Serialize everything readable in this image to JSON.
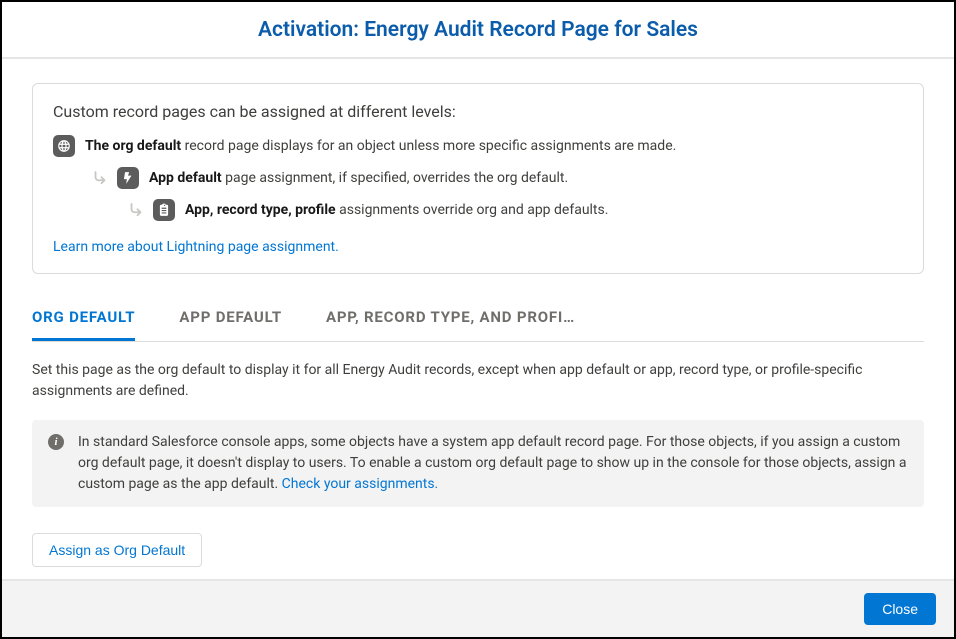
{
  "header": {
    "title": "Activation: Energy Audit Record Page for Sales"
  },
  "info": {
    "title": "Custom record pages can be assigned at different levels:",
    "levels": [
      {
        "label": "The org default",
        "desc": " record page displays for an object unless more specific assignments are made."
      },
      {
        "label": "App default",
        "desc": " page assignment, if specified, overrides the org default."
      },
      {
        "label": "App, record type, profile",
        "desc": " assignments override org and app defaults."
      }
    ],
    "learn_link": "Learn more about Lightning page assignment."
  },
  "tabs": [
    {
      "label": "ORG DEFAULT",
      "active": true
    },
    {
      "label": "APP DEFAULT",
      "active": false
    },
    {
      "label": "APP, RECORD TYPE, AND PROFI…",
      "active": false
    }
  ],
  "body": {
    "description": "Set this page as the org default to display it for all Energy Audit records, except when app default or app, record type, or profile-specific assignments are defined.",
    "notice": "In standard Salesforce console apps, some objects have a system app default record page. For those objects, if you assign a custom org default page, it doesn't display to users. To enable a custom org default page to show up in the console for those objects, assign a custom page as the app default.  ",
    "notice_link": "Check your assignments.",
    "assign_button": "Assign as Org Default"
  },
  "footer": {
    "close": "Close"
  }
}
